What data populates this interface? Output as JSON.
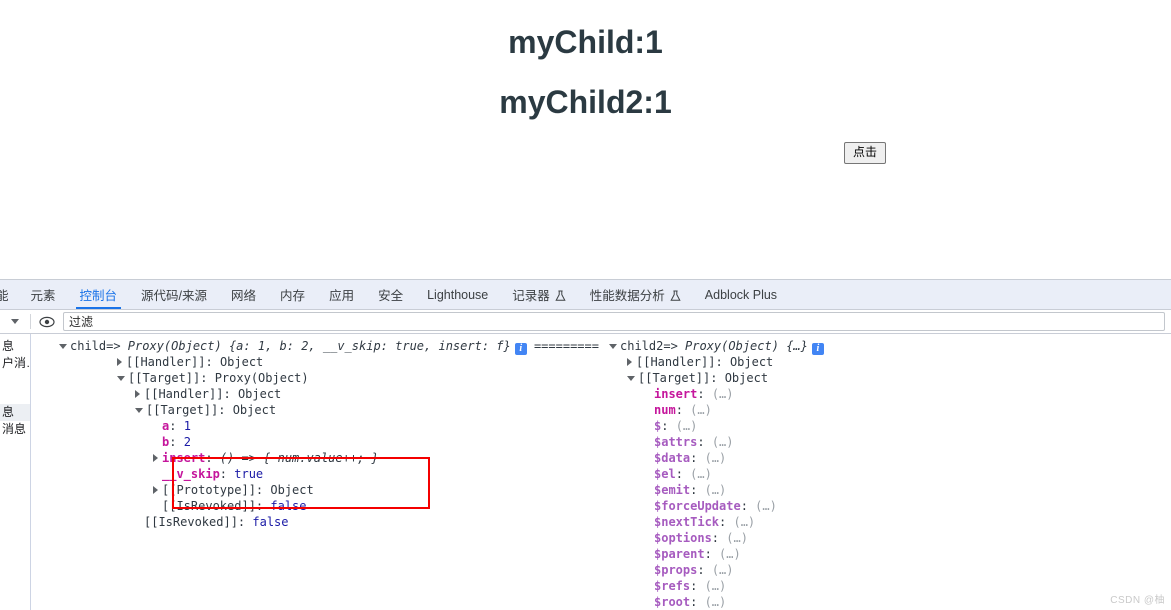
{
  "page": {
    "heading1": "myChild:1",
    "heading2": "myChild2:1",
    "button_label": "点击"
  },
  "devtools": {
    "tabs": [
      {
        "label": "能",
        "active": false,
        "flask": false,
        "truncated": true
      },
      {
        "label": "元素",
        "active": false,
        "flask": false
      },
      {
        "label": "控制台",
        "active": true,
        "flask": false
      },
      {
        "label": "源代码/来源",
        "active": false,
        "flask": false
      },
      {
        "label": "网络",
        "active": false,
        "flask": false
      },
      {
        "label": "内存",
        "active": false,
        "flask": false
      },
      {
        "label": "应用",
        "active": false,
        "flask": false
      },
      {
        "label": "安全",
        "active": false,
        "flask": false
      },
      {
        "label": "Lighthouse",
        "active": false,
        "flask": false
      },
      {
        "label": "记录器",
        "active": false,
        "flask": true
      },
      {
        "label": "性能数据分析",
        "active": false,
        "flask": true
      },
      {
        "label": "Adblock Plus",
        "active": false,
        "flask": false
      }
    ],
    "filterbar": {
      "caret_icon": "chevron-down-icon",
      "eye_icon": "eye-icon",
      "filter_value": "过滤",
      "filter_placeholder": "过滤"
    },
    "sidebar": {
      "items": [
        {
          "label": "息",
          "selected": false
        },
        {
          "label": "户消…",
          "selected": false
        },
        {
          "label": "息",
          "selected": true
        },
        {
          "label": "消息",
          "selected": false
        }
      ]
    },
    "console": {
      "left": [
        {
          "indent": 0,
          "arrow": "down",
          "parts": [
            {
              "t": "child=> ",
              "c": "k-eq"
            },
            {
              "t": "Proxy(Object) ",
              "c": "k-proxy"
            },
            {
              "t": "{a: 1, b: 2, __v_skip: true, insert: f}",
              "c": "k-italic"
            }
          ],
          "info": true
        },
        {
          "indent": 1,
          "arrow": "right",
          "parts": [
            {
              "t": "[[Handler]]",
              "c": "k-label"
            },
            {
              "t": ": ",
              "c": "k-plain"
            },
            {
              "t": "Object",
              "c": "k-obj"
            }
          ]
        },
        {
          "indent": 1,
          "arrow": "down",
          "parts": [
            {
              "t": "[[Target]]",
              "c": "k-label"
            },
            {
              "t": ": ",
              "c": "k-plain"
            },
            {
              "t": "Proxy(Object)",
              "c": "k-obj"
            }
          ]
        },
        {
          "indent": 2,
          "arrow": "right",
          "parts": [
            {
              "t": "[[Handler]]",
              "c": "k-label"
            },
            {
              "t": ": ",
              "c": "k-plain"
            },
            {
              "t": "Object",
              "c": "k-obj"
            }
          ]
        },
        {
          "indent": 2,
          "arrow": "down",
          "parts": [
            {
              "t": "[[Target]]",
              "c": "k-label"
            },
            {
              "t": ": ",
              "c": "k-plain"
            },
            {
              "t": "Object",
              "c": "k-obj"
            }
          ]
        },
        {
          "indent": 3,
          "arrow": "none",
          "parts": [
            {
              "t": "a",
              "c": "k-prop"
            },
            {
              "t": ": ",
              "c": "k-plain"
            },
            {
              "t": "1",
              "c": "k-num"
            }
          ]
        },
        {
          "indent": 3,
          "arrow": "none",
          "parts": [
            {
              "t": "b",
              "c": "k-prop"
            },
            {
              "t": ": ",
              "c": "k-plain"
            },
            {
              "t": "2",
              "c": "k-num"
            }
          ]
        },
        {
          "indent": 3,
          "arrow": "right",
          "parts": [
            {
              "t": "insert",
              "c": "k-prop"
            },
            {
              "t": ": ",
              "c": "k-plain"
            },
            {
              "t": "() => { num.value++; }",
              "c": "k-fn"
            }
          ]
        },
        {
          "indent": 3,
          "arrow": "none",
          "parts": [
            {
              "t": "__v_skip",
              "c": "k-vskip"
            },
            {
              "t": ": ",
              "c": "k-plain"
            },
            {
              "t": "true",
              "c": "k-bool"
            }
          ]
        },
        {
          "indent": 3,
          "arrow": "right",
          "parts": [
            {
              "t": "[[Prototype]]",
              "c": "k-label"
            },
            {
              "t": ": ",
              "c": "k-plain"
            },
            {
              "t": "Object",
              "c": "k-obj"
            }
          ]
        },
        {
          "indent": 3,
          "arrow": "none",
          "parts": [
            {
              "t": "[[IsRevoked]]",
              "c": "k-label"
            },
            {
              "t": ": ",
              "c": "k-plain"
            },
            {
              "t": "false",
              "c": "k-bool"
            }
          ]
        },
        {
          "indent": 2,
          "arrow": "none",
          "parts": [
            {
              "t": "[[IsRevoked]]",
              "c": "k-label"
            },
            {
              "t": ": ",
              "c": "k-plain"
            },
            {
              "t": "false",
              "c": "k-bool"
            }
          ]
        }
      ],
      "separator": "=========",
      "right": [
        {
          "indent": 0,
          "arrow": "down",
          "parts": [
            {
              "t": "child2=> ",
              "c": "k-eq"
            },
            {
              "t": "Proxy(Object) ",
              "c": "k-proxy"
            },
            {
              "t": "{…}",
              "c": "k-italic"
            }
          ],
          "info": true
        },
        {
          "indent": 1,
          "arrow": "right",
          "parts": [
            {
              "t": "[[Handler]]",
              "c": "k-label"
            },
            {
              "t": ": ",
              "c": "k-plain"
            },
            {
              "t": "Object",
              "c": "k-obj"
            }
          ]
        },
        {
          "indent": 1,
          "arrow": "down",
          "parts": [
            {
              "t": "[[Target]]",
              "c": "k-label"
            },
            {
              "t": ": ",
              "c": "k-plain"
            },
            {
              "t": "Object",
              "c": "k-obj"
            }
          ]
        },
        {
          "indent": 2,
          "arrow": "none",
          "parts": [
            {
              "t": "insert",
              "c": "k-prop"
            },
            {
              "t": ": ",
              "c": "k-plain"
            },
            {
              "t": "(…)",
              "c": "k-dim"
            }
          ]
        },
        {
          "indent": 2,
          "arrow": "none",
          "parts": [
            {
              "t": "num",
              "c": "k-prop"
            },
            {
              "t": ": ",
              "c": "k-plain"
            },
            {
              "t": "(…)",
              "c": "k-dim"
            }
          ]
        },
        {
          "indent": 2,
          "arrow": "none",
          "parts": [
            {
              "t": "$",
              "c": "k-propdim"
            },
            {
              "t": ": ",
              "c": "k-plain"
            },
            {
              "t": "(…)",
              "c": "k-dim"
            }
          ]
        },
        {
          "indent": 2,
          "arrow": "none",
          "parts": [
            {
              "t": "$attrs",
              "c": "k-propdim"
            },
            {
              "t": ": ",
              "c": "k-plain"
            },
            {
              "t": "(…)",
              "c": "k-dim"
            }
          ]
        },
        {
          "indent": 2,
          "arrow": "none",
          "parts": [
            {
              "t": "$data",
              "c": "k-propdim"
            },
            {
              "t": ": ",
              "c": "k-plain"
            },
            {
              "t": "(…)",
              "c": "k-dim"
            }
          ]
        },
        {
          "indent": 2,
          "arrow": "none",
          "parts": [
            {
              "t": "$el",
              "c": "k-propdim"
            },
            {
              "t": ": ",
              "c": "k-plain"
            },
            {
              "t": "(…)",
              "c": "k-dim"
            }
          ]
        },
        {
          "indent": 2,
          "arrow": "none",
          "parts": [
            {
              "t": "$emit",
              "c": "k-propdim"
            },
            {
              "t": ": ",
              "c": "k-plain"
            },
            {
              "t": "(…)",
              "c": "k-dim"
            }
          ]
        },
        {
          "indent": 2,
          "arrow": "none",
          "parts": [
            {
              "t": "$forceUpdate",
              "c": "k-propdim"
            },
            {
              "t": ": ",
              "c": "k-plain"
            },
            {
              "t": "(…)",
              "c": "k-dim"
            }
          ]
        },
        {
          "indent": 2,
          "arrow": "none",
          "parts": [
            {
              "t": "$nextTick",
              "c": "k-propdim"
            },
            {
              "t": ": ",
              "c": "k-plain"
            },
            {
              "t": "(…)",
              "c": "k-dim"
            }
          ]
        },
        {
          "indent": 2,
          "arrow": "none",
          "parts": [
            {
              "t": "$options",
              "c": "k-propdim"
            },
            {
              "t": ": ",
              "c": "k-plain"
            },
            {
              "t": "(…)",
              "c": "k-dim"
            }
          ]
        },
        {
          "indent": 2,
          "arrow": "none",
          "parts": [
            {
              "t": "$parent",
              "c": "k-propdim"
            },
            {
              "t": ": ",
              "c": "k-plain"
            },
            {
              "t": "(…)",
              "c": "k-dim"
            }
          ]
        },
        {
          "indent": 2,
          "arrow": "none",
          "parts": [
            {
              "t": "$props",
              "c": "k-propdim"
            },
            {
              "t": ": ",
              "c": "k-plain"
            },
            {
              "t": "(…)",
              "c": "k-dim"
            }
          ]
        },
        {
          "indent": 2,
          "arrow": "none",
          "parts": [
            {
              "t": "$refs",
              "c": "k-propdim"
            },
            {
              "t": ": ",
              "c": "k-plain"
            },
            {
              "t": "(…)",
              "c": "k-dim"
            }
          ]
        },
        {
          "indent": 2,
          "arrow": "none",
          "parts": [
            {
              "t": "$root",
              "c": "k-propdim"
            },
            {
              "t": ": ",
              "c": "k-plain"
            },
            {
              "t": "(…)",
              "c": "k-dim"
            }
          ]
        }
      ]
    }
  },
  "watermark": "CSDN @柚"
}
